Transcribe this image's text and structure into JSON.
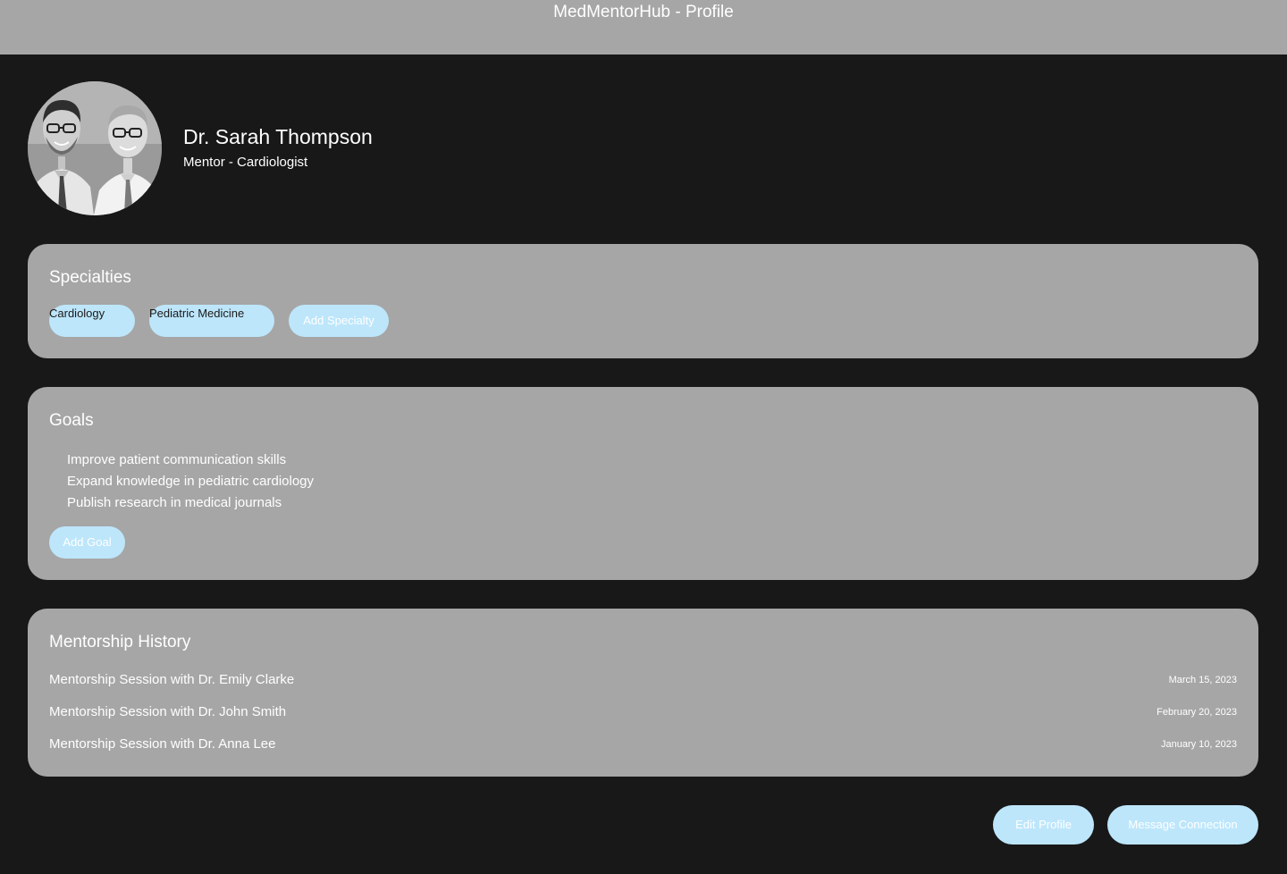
{
  "app": {
    "title": "MedMentorHub - Profile"
  },
  "profile": {
    "name": "Dr. Sarah Thompson",
    "role": "Mentor - Cardiologist",
    "avatar_icon": "profile-photo"
  },
  "specialties": {
    "title": "Specialties",
    "items": [
      "Cardiology",
      "Pediatric Medicine"
    ],
    "add_label": "Add Specialty"
  },
  "goals": {
    "title": "Goals",
    "items": [
      "Improve patient communication skills",
      "Expand knowledge in pediatric cardiology",
      "Publish research in medical journals"
    ],
    "add_label": "Add Goal"
  },
  "history": {
    "title": "Mentorship History",
    "sessions": [
      {
        "title": "Mentorship Session with Dr. Emily Clarke",
        "date": "March 15, 2023"
      },
      {
        "title": "Mentorship Session with Dr. John Smith",
        "date": "February 20, 2023"
      },
      {
        "title": "Mentorship Session with Dr. Anna Lee",
        "date": "January 10, 2023"
      }
    ]
  },
  "actions": {
    "edit_label": "Edit Profile",
    "message_label": "Message Connection"
  },
  "colors": {
    "page_background": "#181818",
    "panel": "#a6a6a6",
    "accent": "#bde6fb",
    "text": "#ffffff"
  }
}
